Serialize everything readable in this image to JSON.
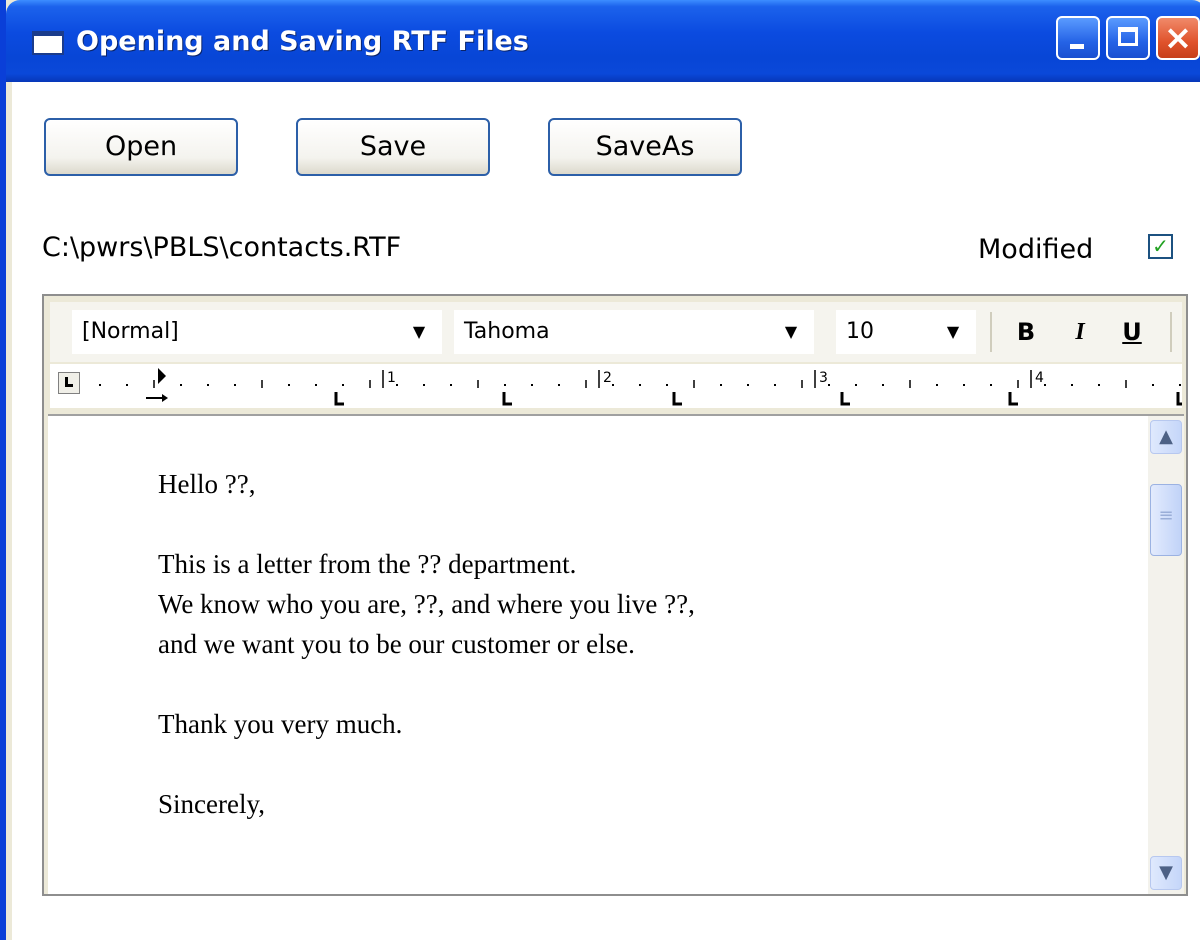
{
  "window": {
    "title": "Opening and Saving RTF Files",
    "controls": {
      "minimize": "_",
      "maximize": "□",
      "close": "×"
    }
  },
  "buttons": {
    "open_label": "Open",
    "save_label": "Save",
    "saveas_label": "SaveAs"
  },
  "file_path": "C:\\pwrs\\PBLS\\contacts.RTF",
  "modified": {
    "label": "Modified",
    "checked": true,
    "check_glyph": "✓"
  },
  "toolbar": {
    "style": "[Normal]",
    "font": "Tahoma",
    "size": "10",
    "bold": "B",
    "italic": "I",
    "underline": "U",
    "dropdown_glyph": "▼"
  },
  "ruler": {
    "labels": [
      "1",
      "2",
      "3",
      "4"
    ]
  },
  "document": {
    "lines": [
      "Hello ??,",
      "",
      "This is a letter from the ?? department.",
      "We know who you are, ??, and where you live ??,",
      "and we want you to be our customer or else.",
      "",
      "Thank you very much.",
      "",
      "Sincerely,"
    ]
  },
  "scrollbar": {
    "up_glyph": "▲",
    "down_glyph": "▼"
  },
  "colors": {
    "titlebar": "#0846d6",
    "button_border": "#2c5fa8",
    "checkbox_check": "#21a121"
  }
}
